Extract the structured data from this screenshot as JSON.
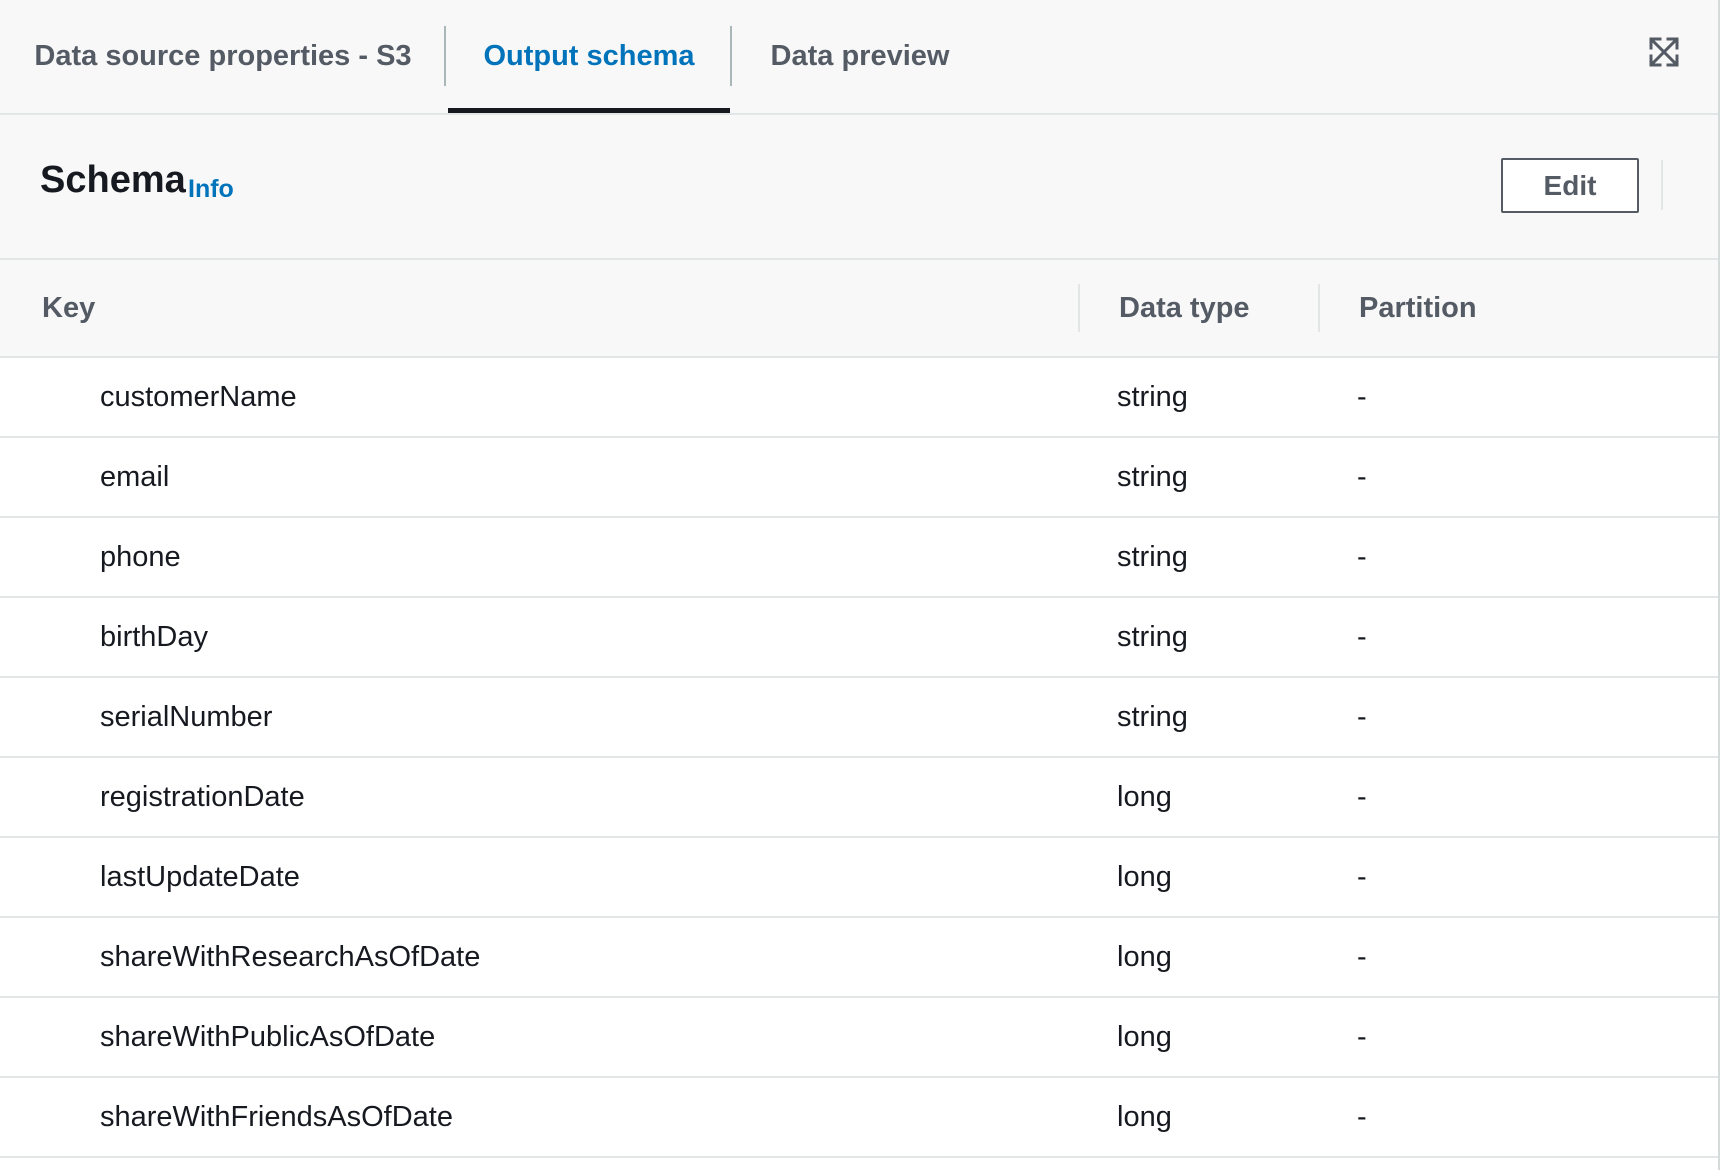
{
  "tabs": [
    {
      "label": "Data source properties - S3",
      "active": false
    },
    {
      "label": "Output schema",
      "active": true
    },
    {
      "label": "Data preview",
      "active": false
    }
  ],
  "header": {
    "title": "Schema",
    "info_label": "Info",
    "edit_label": "Edit"
  },
  "table": {
    "columns": [
      "Key",
      "Data type",
      "Partition"
    ],
    "rows": [
      {
        "key": "customerName",
        "type": "string",
        "partition": "-"
      },
      {
        "key": "email",
        "type": "string",
        "partition": "-"
      },
      {
        "key": "phone",
        "type": "string",
        "partition": "-"
      },
      {
        "key": "birthDay",
        "type": "string",
        "partition": "-"
      },
      {
        "key": "serialNumber",
        "type": "string",
        "partition": "-"
      },
      {
        "key": "registrationDate",
        "type": "long",
        "partition": "-"
      },
      {
        "key": "lastUpdateDate",
        "type": "long",
        "partition": "-"
      },
      {
        "key": "shareWithResearchAsOfDate",
        "type": "long",
        "partition": "-"
      },
      {
        "key": "shareWithPublicAsOfDate",
        "type": "long",
        "partition": "-"
      },
      {
        "key": "shareWithFriendsAsOfDate",
        "type": "long",
        "partition": "-"
      }
    ]
  },
  "icons": {
    "expand": "expand-icon"
  },
  "colors": {
    "accent": "#0073bb",
    "text": "#16191f",
    "muted": "#545b64",
    "border": "#e3e6e6"
  }
}
